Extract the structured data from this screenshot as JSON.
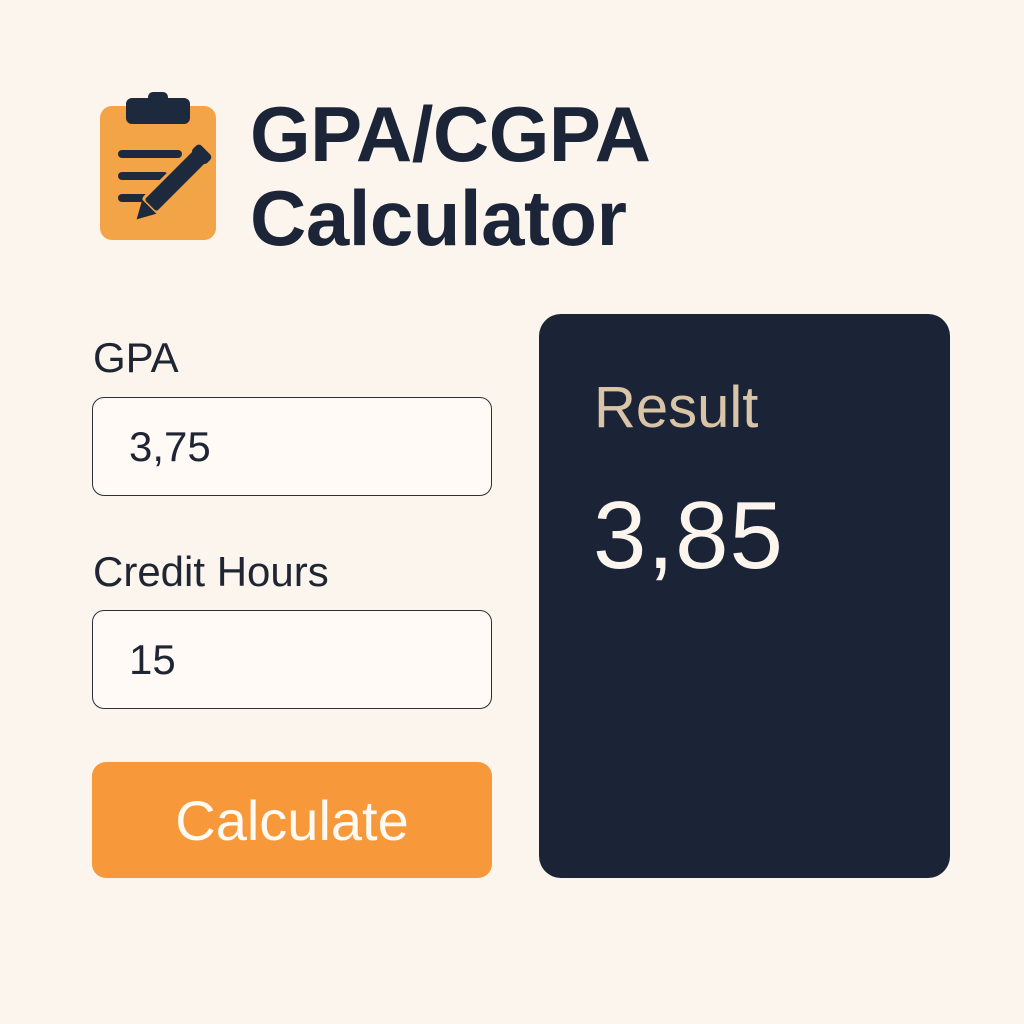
{
  "header": {
    "icon": "clipboard-pencil-icon",
    "title_line1": "GPA/CGPA",
    "title_line2": "Calculator"
  },
  "form": {
    "gpa_label": "GPA",
    "gpa_value": "3,75",
    "credit_label": "Credit Hours",
    "credit_value": "15",
    "calculate_label": "Calculate"
  },
  "result": {
    "label": "Result",
    "value": "3,85"
  },
  "colors": {
    "background": "#fcf5ee",
    "accent_orange": "#f7993a",
    "navy": "#1b2436",
    "result_label": "#d9c4a8"
  }
}
